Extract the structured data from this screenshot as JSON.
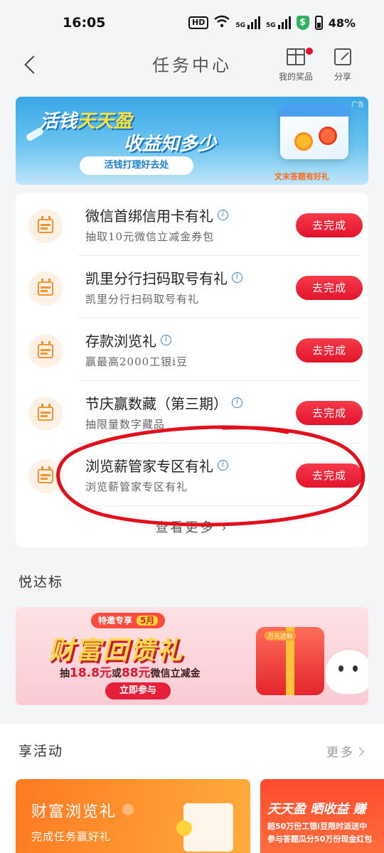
{
  "status_bar": {
    "time": "16:05",
    "hd": "HD",
    "net1": "5G",
    "net2": "5G",
    "battery": "48%"
  },
  "nav": {
    "title": "任务中心",
    "prizes_label": "我的奖品",
    "share_label": "分享"
  },
  "top_banner": {
    "ad_tag": "广告",
    "line1_a": "活钱",
    "line1_b": "天天盈",
    "line2": "收益知多少",
    "pill": "活钱打理好去处",
    "caption": "文末答题有好礼"
  },
  "tasks": [
    {
      "title": "微信首绑信用卡有礼",
      "subtitle": "抽取10元微信立减金券包",
      "button": "去完成"
    },
    {
      "title": "凯里分行扫码取号有礼",
      "subtitle": "凯里分行扫码取号有礼",
      "button": "去完成"
    },
    {
      "title": "存款浏览礼",
      "subtitle": "赢最高2000工银i豆",
      "button": "去完成"
    },
    {
      "title": "节庆赢数藏（第三期）",
      "subtitle": "抽限量数字藏品",
      "button": "去完成"
    },
    {
      "title": "浏览薪管家专区有礼",
      "subtitle": "浏览薪管家专区有礼",
      "button": "去完成"
    }
  ],
  "see_more": "查看更多",
  "yueda": {
    "label": "悦达标",
    "pill": "特邀专享",
    "month": "5月",
    "title": "财富回馈礼",
    "desc_a": "抽",
    "desc_amt1": "18.8元",
    "desc_mid": "或",
    "desc_amt2": "88元",
    "desc_b": "微信立减金",
    "button": "立即参与",
    "box_label": "万元达标"
  },
  "xiang": {
    "label": "享活动",
    "more": "更多",
    "card1_title": "财富浏览礼",
    "card1_sub": "完成任务赢好礼",
    "card2_title": "天天盈 晒收益 赚",
    "card2_line1": "超50万份工银i豆限时派送中",
    "card2_line2": "参与答题瓜分50万份现金红包"
  },
  "colors": {
    "accent_red": "#e3142d",
    "task_icon_orange": "#f29530",
    "annotation_red": "#e0101c"
  }
}
